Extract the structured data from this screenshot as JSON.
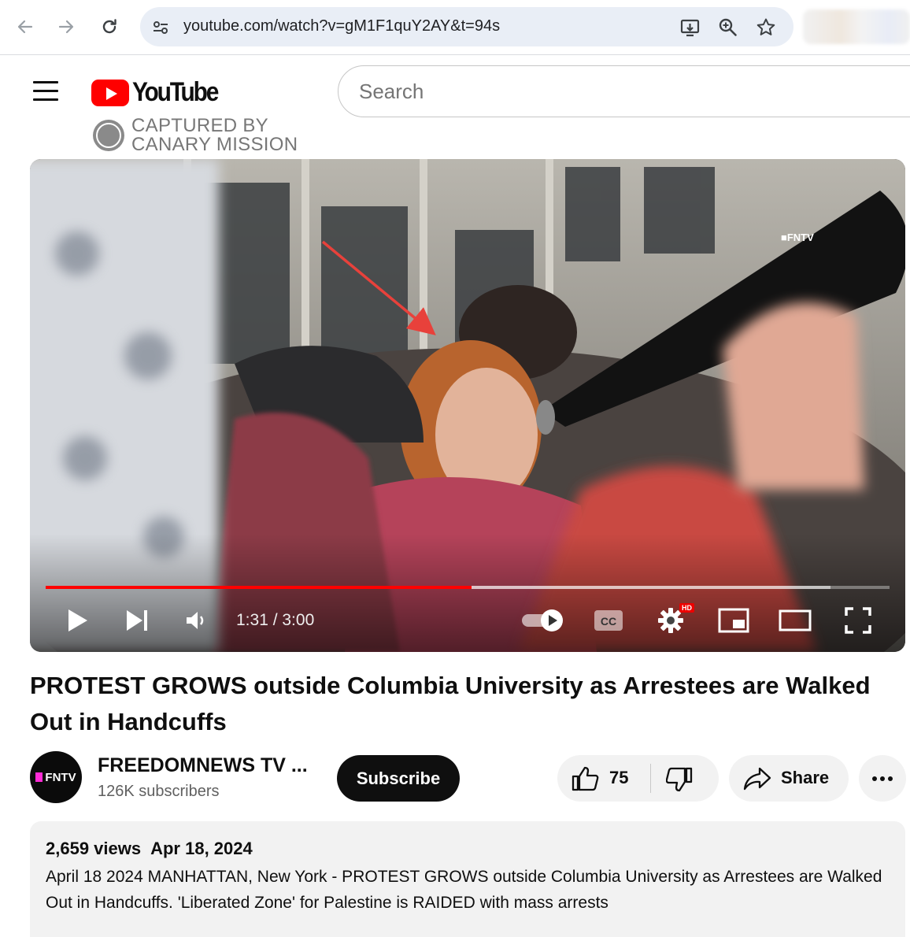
{
  "browser": {
    "url": "youtube.com/watch?v=gM1F1quY2AY&t=94s",
    "icons": [
      "back-arrow-icon",
      "forward-arrow-icon",
      "reload-icon",
      "site-settings-icon",
      "install-app-icon",
      "zoom-icon",
      "bookmark-star-icon"
    ]
  },
  "masthead": {
    "logo_text": "YouTube",
    "search_placeholder": "Search"
  },
  "watermark": {
    "line1": "CAPTURED BY",
    "line2": "CANARY MISSION"
  },
  "player": {
    "overlay_tag": "■FNTV",
    "time_current": "1:31",
    "time_total": "3:00",
    "time_display": "1:31 / 3:00",
    "progress_fraction": 0.505,
    "buffer_fraction": 0.93,
    "hd_badge": "HD",
    "accent_color": "#ff0000"
  },
  "video": {
    "title": "PROTEST GROWS outside Columbia University as Arrestees are Walked Out in Handcuffs"
  },
  "channel": {
    "avatar_text": "FNTV",
    "name": "FREEDOMNEWS TV ...",
    "subscribers": "126K subscribers",
    "subscribe_label": "Subscribe"
  },
  "actions": {
    "like_count": "75",
    "share_label": "Share"
  },
  "description": {
    "views": "2,659 views",
    "date": "Apr 18, 2024",
    "text": "April 18 2024 MANHATTAN, New York - PROTEST GROWS outside Columbia University as Arrestees are Walked Out in Handcuffs. 'Liberated Zone' for Palestine is RAIDED with mass arrests"
  }
}
